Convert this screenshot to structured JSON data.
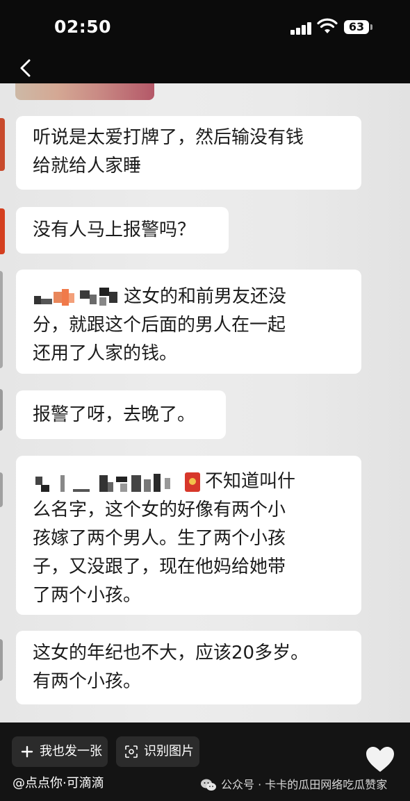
{
  "status_bar": {
    "time": "02:50",
    "battery": "63"
  },
  "messages": [
    {
      "text": "听说是太爱打牌了，然后输没有钱\n给就给人家睡"
    },
    {
      "text": "没有人马上报警吗？"
    },
    {
      "text": "这女的和前男友还没\n分，就跟这个后面的男人在一起\n还用了人家的钱。"
    },
    {
      "text": "报警了呀，去晚了。"
    },
    {
      "text": "不知道叫什\n么名字，这个女的好像有两个小\n孩嫁了两个男人。生了两个小孩\n子，又没跟了，现在他妈给她带\n了两个小孩。"
    },
    {
      "text": "这女的年纪也不大，应该20多岁。\n有两个小孩。"
    }
  ],
  "bottom_bar": {
    "post_button": "我也发一张",
    "recognize_button": "识别图片",
    "author_line": "@点点你·可滴滴",
    "wechat_watermark": "公众号 · 卡卡的瓜田网络吃瓜赞家"
  },
  "icons": {
    "back": "back-arrow-icon",
    "plus": "plus-icon",
    "scan": "scan-icon",
    "like": "heart-icon",
    "wechat": "wechat-icon"
  },
  "colors": {
    "background": "#0b0b0b",
    "bubble": "#ffffff",
    "photo_bg": "#e8e8e8",
    "bottom_bar": "#141414",
    "pill": "#2b2b2b"
  }
}
